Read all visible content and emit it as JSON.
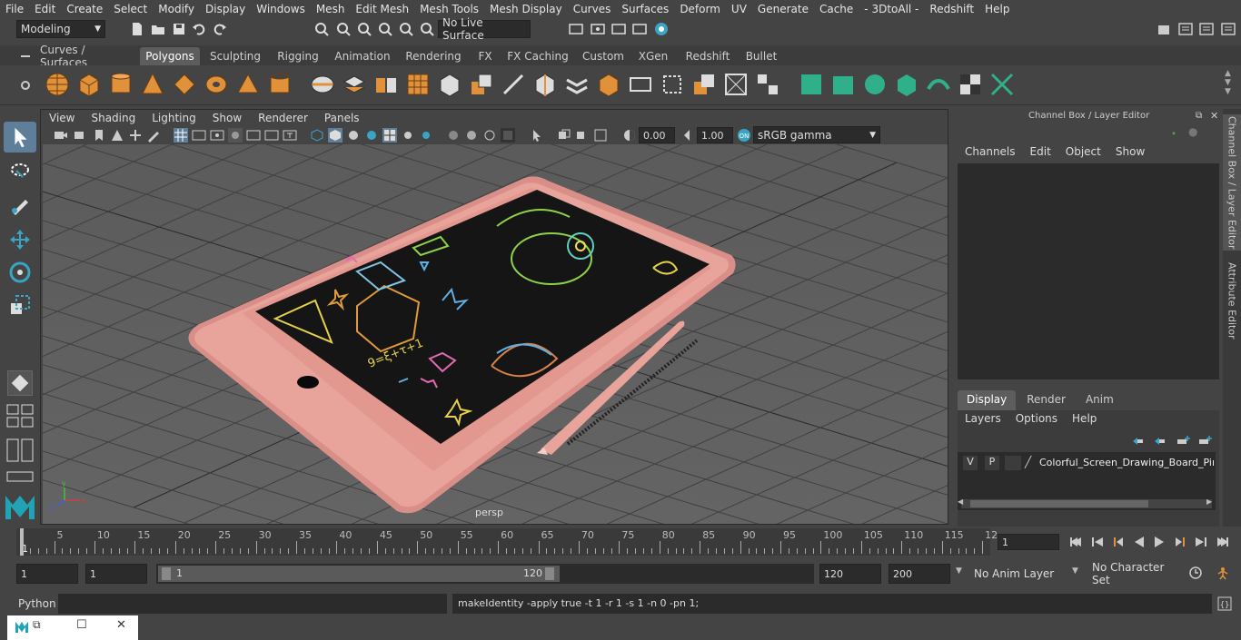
{
  "menubar": {
    "items": [
      "File",
      "Edit",
      "Create",
      "Select",
      "Modify",
      "Display",
      "Windows",
      "Mesh",
      "Edit Mesh",
      "Mesh Tools",
      "Mesh Display",
      "Curves",
      "Surfaces",
      "Deform",
      "UV",
      "Generate",
      "Cache",
      "- 3DtoAll -",
      "Redshift",
      "Help"
    ]
  },
  "statusline": {
    "mode": "Modeling",
    "live_surface": "No Live Surface"
  },
  "shelf": {
    "tabs": [
      "Curves / Surfaces",
      "Polygons",
      "Sculpting",
      "Rigging",
      "Animation",
      "Rendering",
      "FX",
      "FX Caching",
      "Custom",
      "XGen",
      "Redshift",
      "Bullet"
    ],
    "active_tab": "Polygons"
  },
  "viewport": {
    "menu": [
      "View",
      "Shading",
      "Lighting",
      "Show",
      "Renderer",
      "Panels"
    ],
    "exposure": "0.00",
    "gamma": "1.00",
    "color_space": "sRGB gamma",
    "camera_label": "persp",
    "screen_text": "9=ξ+τ+1",
    "accent_color": "#e8998d"
  },
  "channel_box": {
    "title": "Channel Box / Layer Editor",
    "menu": [
      "Channels",
      "Edit",
      "Object",
      "Show"
    ],
    "layer_tabs": [
      "Display",
      "Render",
      "Anim"
    ],
    "active_layer_tab": "Display",
    "layer_menu": [
      "Layers",
      "Options",
      "Help"
    ],
    "layer": {
      "v": "V",
      "p": "P",
      "name": "Colorful_Screen_Drawing_Board_Pink"
    }
  },
  "side_tabs": [
    "Channel Box / Layer Editor",
    "Attribute Editor"
  ],
  "timeline": {
    "ticks": [
      "5",
      "10",
      "15",
      "20",
      "25",
      "30",
      "35",
      "40",
      "45",
      "50",
      "55",
      "60",
      "65",
      "70",
      "75",
      "80",
      "85",
      "90",
      "95",
      "100",
      "105",
      "110",
      "115",
      "12"
    ],
    "start_mark": "1",
    "current_frame": "1"
  },
  "range": {
    "start": "1",
    "playback_start": "1",
    "slider_start": "1",
    "slider_end": "120",
    "playback_end": "120",
    "end": "200",
    "anim_layer": "No Anim Layer",
    "character_set": "No Character Set"
  },
  "cmdline": {
    "language": "Python",
    "output": "makeIdentity -apply true -t 1 -r 1 -s 1 -n 0 -pn 1;"
  }
}
